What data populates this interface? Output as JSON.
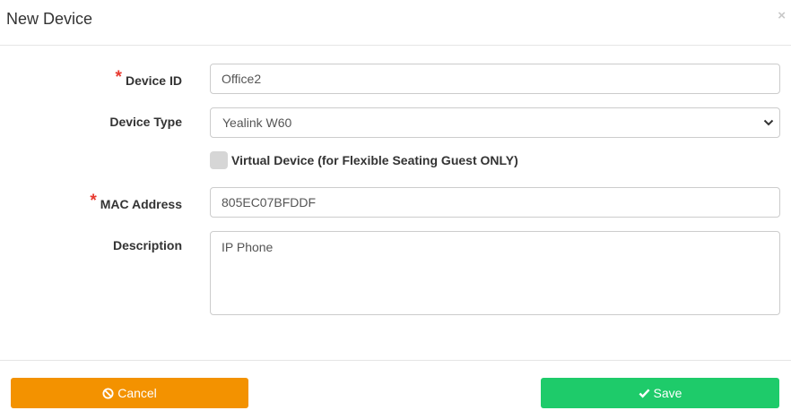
{
  "dialog": {
    "title": "New Device",
    "close_label": "×"
  },
  "form": {
    "required_marker": "*",
    "device_id": {
      "label": "Device ID",
      "value": "Office2",
      "required": true
    },
    "device_type": {
      "label": "Device Type",
      "value": "Yealink W60"
    },
    "virtual_device": {
      "label": "Virtual Device (for Flexible Seating Guest ONLY)",
      "checked": false
    },
    "mac_address": {
      "label": "MAC Address",
      "value": "805EC07BFDDF",
      "required": true
    },
    "description": {
      "label": "Description",
      "value": "IP Phone"
    }
  },
  "footer": {
    "cancel_label": "Cancel",
    "save_label": "Save"
  },
  "icons": {
    "cancel": "ban-icon",
    "save": "check-icon",
    "dropdown": "chevron-down-icon",
    "close": "close-icon"
  },
  "colors": {
    "required": "#e8392f",
    "cancel_button": "#f39200",
    "save_button": "#1ecb6a"
  }
}
